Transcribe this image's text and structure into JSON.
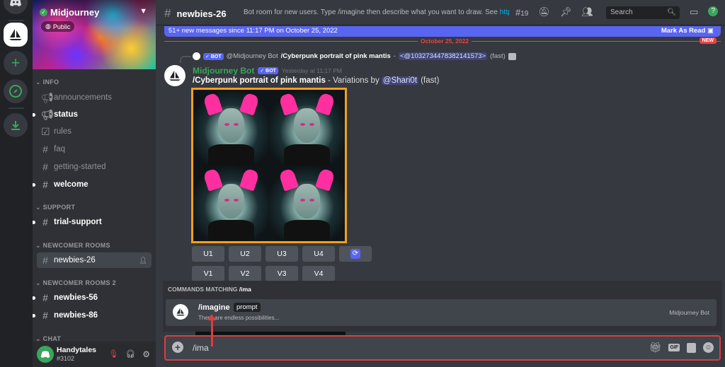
{
  "server": {
    "name": "Midjourney",
    "visibility": "Public"
  },
  "categories": {
    "info": "INFO",
    "support": "SUPPORT",
    "newcomer": "NEWCOMER ROOMS",
    "newcomer2": "NEWCOMER ROOMS 2",
    "chat": "CHAT"
  },
  "channels": {
    "announcements": "announcements",
    "status": "status",
    "rules": "rules",
    "faq": "faq",
    "getting_started": "getting-started",
    "welcome": "welcome",
    "trial_support": "trial-support",
    "newbies_26": "newbies-26",
    "newbies_56": "newbies-56",
    "newbies_86": "newbies-86"
  },
  "user": {
    "name": "Handytales",
    "tag": "#3102"
  },
  "header": {
    "channel": "newbies-26",
    "topic": "Bot room for new users. Type /imagine then describe what you want to draw. See ",
    "topic_link": "https:",
    "thread_count": "19",
    "search_placeholder": "Search"
  },
  "unread_banner": {
    "text": "51+ new messages since 11:17 PM on October 25, 2022",
    "action": "Mark As Read"
  },
  "divider": {
    "date": "October 25, 2022",
    "new_label": "NEW"
  },
  "reply": {
    "bot_badge": "BOT",
    "author": "@Midjourney Bot",
    "prompt": "/Cyberpunk portrait of pink mantis",
    "separator": " - ",
    "mention": "<@1032734478382141573>",
    "speed": "(fast)"
  },
  "message": {
    "author": "Midjourney Bot",
    "bot_badge": "BOT",
    "timestamp": "Yesterday at 11:17 PM",
    "prompt": "/Cyberpunk portrait of pink mantis",
    "suffix": " - Variations by ",
    "mention": "@Shari0t",
    "speed": " (fast)"
  },
  "buttons": {
    "upscale": [
      "U1",
      "U2",
      "U3",
      "U4"
    ],
    "variation": [
      "V1",
      "V2",
      "V3",
      "V4"
    ]
  },
  "commands": {
    "header_prefix": "COMMANDS MATCHING ",
    "header_query": "/ima",
    "name": "/imagine",
    "option": "prompt",
    "description": "There are endless possibilities...",
    "source": "Midjourney Bot"
  },
  "composer": {
    "value": "/ima"
  },
  "colors": {
    "accent": "#5865f2",
    "highlight": "#e03c3c",
    "grid_border": "#f0a020",
    "bot_name": "#3ba55d"
  }
}
